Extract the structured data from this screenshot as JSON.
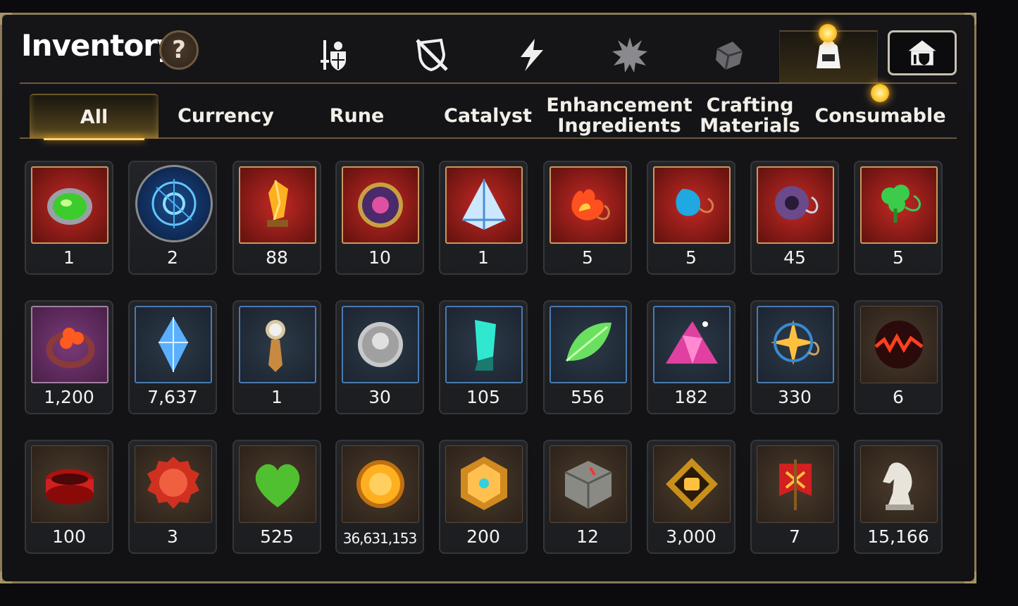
{
  "header": {
    "title": "Inventory",
    "help_label": "?"
  },
  "top_categories": [
    {
      "icon": "sword-shield-icon",
      "active": false
    },
    {
      "icon": "crossed-shield-icon",
      "active": false
    },
    {
      "icon": "lightning-icon",
      "active": false
    },
    {
      "icon": "spiky-burst-icon",
      "active": false
    },
    {
      "icon": "cube-icon",
      "active": false
    },
    {
      "icon": "backpack-icon",
      "active": true
    },
    {
      "icon": "guild-hall-icon",
      "active": false
    }
  ],
  "tabs": [
    {
      "label": "All",
      "active": true
    },
    {
      "label": "Currency",
      "active": false
    },
    {
      "label": "Rune",
      "active": false
    },
    {
      "label": "Catalyst",
      "active": false
    },
    {
      "label": "Enhancement Ingredients",
      "active": false
    },
    {
      "label": "Crafting Materials",
      "active": false
    },
    {
      "label": "Consumable",
      "active": false
    }
  ],
  "items": [
    {
      "icon": "green-gem-icon",
      "count": "1"
    },
    {
      "icon": "blue-rune-orb-icon",
      "count": "2"
    },
    {
      "icon": "amber-crystal-icon",
      "count": "88"
    },
    {
      "icon": "purple-disc-icon",
      "count": "10"
    },
    {
      "icon": "tetra-crystal-icon",
      "count": "1"
    },
    {
      "icon": "fire-necklace-icon",
      "count": "5"
    },
    {
      "icon": "water-necklace-icon",
      "count": "5"
    },
    {
      "icon": "dark-ring-necklace-icon",
      "count": "45"
    },
    {
      "icon": "clover-necklace-icon",
      "count": "5"
    },
    {
      "icon": "clover-ring-icon",
      "count": "1,200"
    },
    {
      "icon": "blue-crystal-icon",
      "count": "7,637"
    },
    {
      "icon": "compass-key-icon",
      "count": "1"
    },
    {
      "icon": "silver-coin-icon",
      "count": "30"
    },
    {
      "icon": "teal-crystal-icon",
      "count": "105"
    },
    {
      "icon": "green-leaf-icon",
      "count": "556"
    },
    {
      "icon": "pink-crystal-pile-icon",
      "count": "182"
    },
    {
      "icon": "star-necklace-icon",
      "count": "330"
    },
    {
      "icon": "fire-orb-icon",
      "count": "6"
    },
    {
      "icon": "red-bracelet-icon",
      "count": "100"
    },
    {
      "icon": "red-badge-icon",
      "count": "3"
    },
    {
      "icon": "green-heart-icon",
      "count": "525"
    },
    {
      "icon": "gold-coin-icon",
      "count": "36,631,153"
    },
    {
      "icon": "gold-emblem-icon",
      "count": "200"
    },
    {
      "icon": "stone-block-icon",
      "count": "12"
    },
    {
      "icon": "fist-badge-icon",
      "count": "3,000"
    },
    {
      "icon": "war-banner-icon",
      "count": "7"
    },
    {
      "icon": "chess-knight-icon",
      "count": "15,166"
    }
  ]
}
